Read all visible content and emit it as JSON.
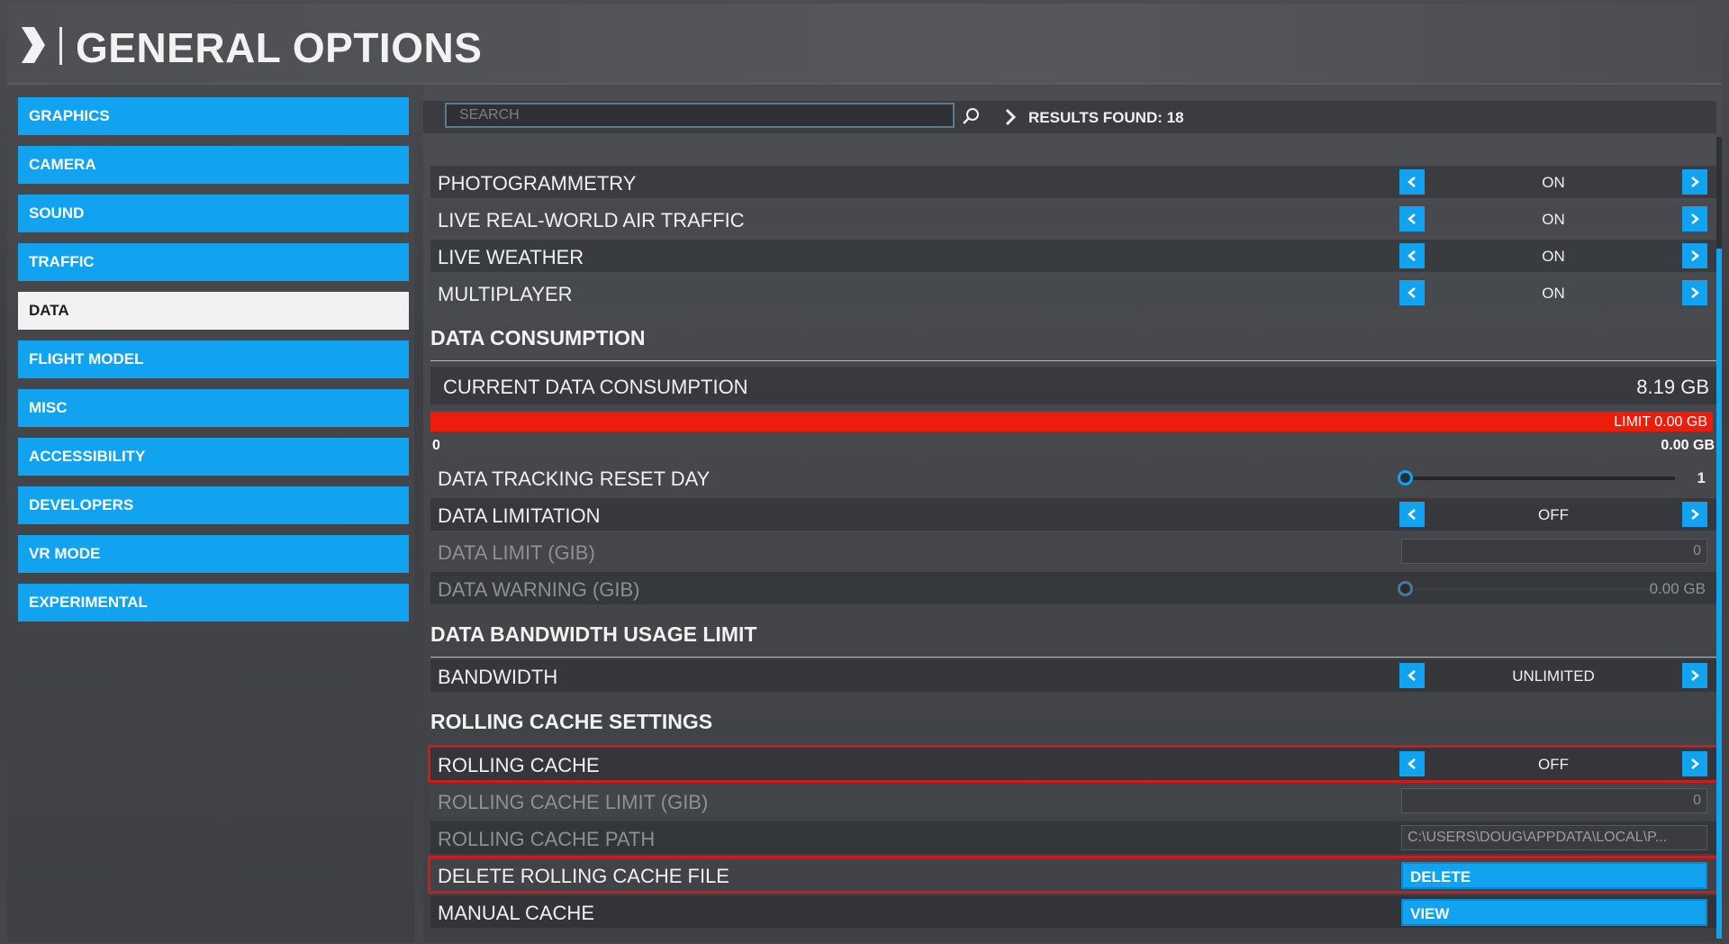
{
  "header": {
    "title": "GENERAL OPTIONS"
  },
  "sidebar": {
    "items": [
      {
        "label": "GRAPHICS"
      },
      {
        "label": "CAMERA"
      },
      {
        "label": "SOUND"
      },
      {
        "label": "TRAFFIC"
      },
      {
        "label": "DATA",
        "active": true
      },
      {
        "label": "FLIGHT MODEL"
      },
      {
        "label": "MISC"
      },
      {
        "label": "ACCESSIBILITY"
      },
      {
        "label": "DEVELOPERS"
      },
      {
        "label": "VR MODE"
      },
      {
        "label": "EXPERIMENTAL"
      }
    ]
  },
  "search": {
    "placeholder": "SEARCH",
    "results": "RESULTS FOUND: 18"
  },
  "rows": {
    "photogrammetry": {
      "label": "PHOTOGRAMMETRY",
      "value": "ON"
    },
    "air_traffic": {
      "label": "LIVE REAL-WORLD AIR TRAFFIC",
      "value": "ON"
    },
    "live_weather": {
      "label": "LIVE WEATHER",
      "value": "ON"
    },
    "multiplayer": {
      "label": "MULTIPLAYER",
      "value": "ON"
    }
  },
  "data_consumption": {
    "section": "DATA CONSUMPTION",
    "current_label": "CURRENT DATA CONSUMPTION",
    "current_value": "8.19 GB",
    "limit_label": "LIMIT 0.00 GB",
    "min_label": "0",
    "max_label": "0.00 GB",
    "reset_day_label": "DATA TRACKING RESET DAY",
    "reset_day_value": "1",
    "reset_day_fraction": 0,
    "limitation_label": "DATA LIMITATION",
    "limitation_value": "OFF",
    "limit_gib_label": "DATA LIMIT (GIB)",
    "limit_gib_value": "0",
    "warning_label": "DATA WARNING (GIB)",
    "warning_value": "0.00 GB",
    "warning_fraction": 0
  },
  "bandwidth": {
    "section": "DATA BANDWIDTH USAGE LIMIT",
    "label": "BANDWIDTH",
    "value": "UNLIMITED"
  },
  "rolling_cache": {
    "section": "ROLLING CACHE SETTINGS",
    "label": "ROLLING CACHE",
    "value": "OFF",
    "limit_label": "ROLLING CACHE LIMIT (GIB)",
    "limit_value": "0",
    "path_label": "ROLLING CACHE PATH",
    "path_value": "C:\\USERS\\DOUG\\APPDATA\\LOCAL\\P...",
    "delete_label": "DELETE ROLLING CACHE FILE",
    "delete_button": "DELETE",
    "manual_label": "MANUAL CACHE",
    "manual_button": "VIEW"
  },
  "colors": {
    "accent": "#11a3ef",
    "progress": "#ee1c0a",
    "highlight": "#d01a1a"
  },
  "icons": {
    "header": "chevron-right-icon",
    "search": "search-icon",
    "left": "chevron-left-icon",
    "right": "chevron-right-icon"
  }
}
